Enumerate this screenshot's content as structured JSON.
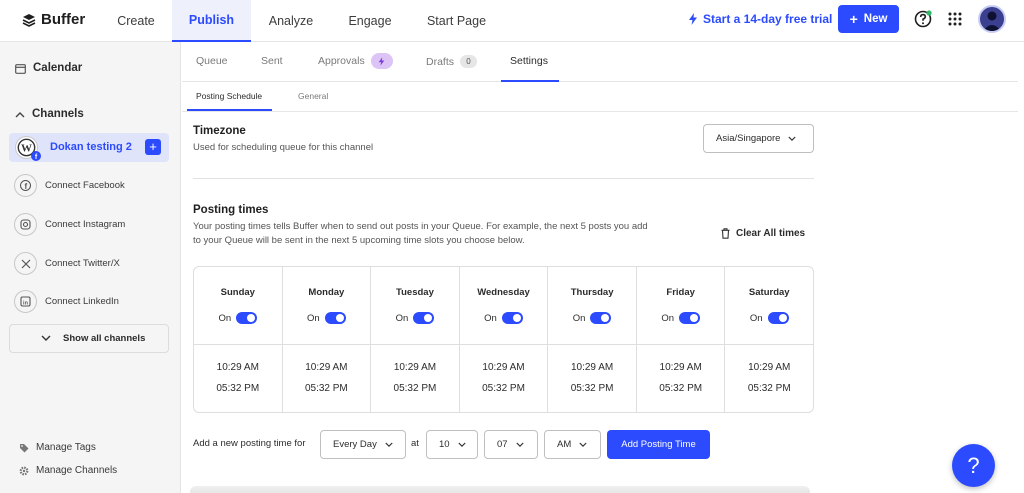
{
  "header": {
    "logo_text": "Buffer",
    "nav": [
      {
        "label": "Create"
      },
      {
        "label": "Publish",
        "active": true
      },
      {
        "label": "Analyze"
      },
      {
        "label": "Engage"
      },
      {
        "label": "Start Page"
      }
    ],
    "trial_label": "Start a 14-day free trial",
    "new_label": "New"
  },
  "sidebar": {
    "calendar_label": "Calendar",
    "channels_label": "Channels",
    "active_channel": "Dokan testing 2",
    "connect_items": [
      {
        "label": "Connect Facebook",
        "icon": "facebook-icon"
      },
      {
        "label": "Connect Instagram",
        "icon": "instagram-icon"
      },
      {
        "label": "Connect Twitter/X",
        "icon": "x-icon"
      },
      {
        "label": "Connect LinkedIn",
        "icon": "linkedin-icon"
      }
    ],
    "show_all_label": "Show all channels",
    "manage_tags_label": "Manage Tags",
    "manage_channels_label": "Manage Channels"
  },
  "tabs": {
    "queue": "Queue",
    "sent": "Sent",
    "approvals": "Approvals",
    "drafts": "Drafts",
    "drafts_count": "0",
    "settings": "Settings"
  },
  "subtabs": {
    "posting_schedule": "Posting Schedule",
    "general": "General"
  },
  "timezone": {
    "title": "Timezone",
    "description": "Used for scheduling queue for this channel",
    "value": "Asia/Singapore"
  },
  "posting_times": {
    "title": "Posting times",
    "description": "Your posting times tells Buffer when to send out posts in your Queue. For example, the next 5 posts you add to your Queue will be sent in the next 5 upcoming time slots you choose below.",
    "clear_label": "Clear All times",
    "days": [
      {
        "day": "Sunday",
        "state": "On",
        "times": [
          "10:29 AM",
          "05:32 PM"
        ]
      },
      {
        "day": "Monday",
        "state": "On",
        "times": [
          "10:29 AM",
          "05:32 PM"
        ]
      },
      {
        "day": "Tuesday",
        "state": "On",
        "times": [
          "10:29 AM",
          "05:32 PM"
        ]
      },
      {
        "day": "Wednesday",
        "state": "On",
        "times": [
          "10:29 AM",
          "05:32 PM"
        ]
      },
      {
        "day": "Thursday",
        "state": "On",
        "times": [
          "10:29 AM",
          "05:32 PM"
        ]
      },
      {
        "day": "Friday",
        "state": "On",
        "times": [
          "10:29 AM",
          "05:32 PM"
        ]
      },
      {
        "day": "Saturday",
        "state": "On",
        "times": [
          "10:29 AM",
          "05:32 PM"
        ]
      }
    ]
  },
  "add_time": {
    "label": "Add a new posting time for",
    "frequency": "Every Day",
    "at_label": "at",
    "hour": "10",
    "minute": "07",
    "ampm": "AM",
    "button_label": "Add Posting Time"
  },
  "help_fab_label": "?",
  "colors": {
    "accent": "#2c4bff",
    "approvals_badge": "#dcc4f7",
    "active_tab_bg": "#eef0fb"
  }
}
